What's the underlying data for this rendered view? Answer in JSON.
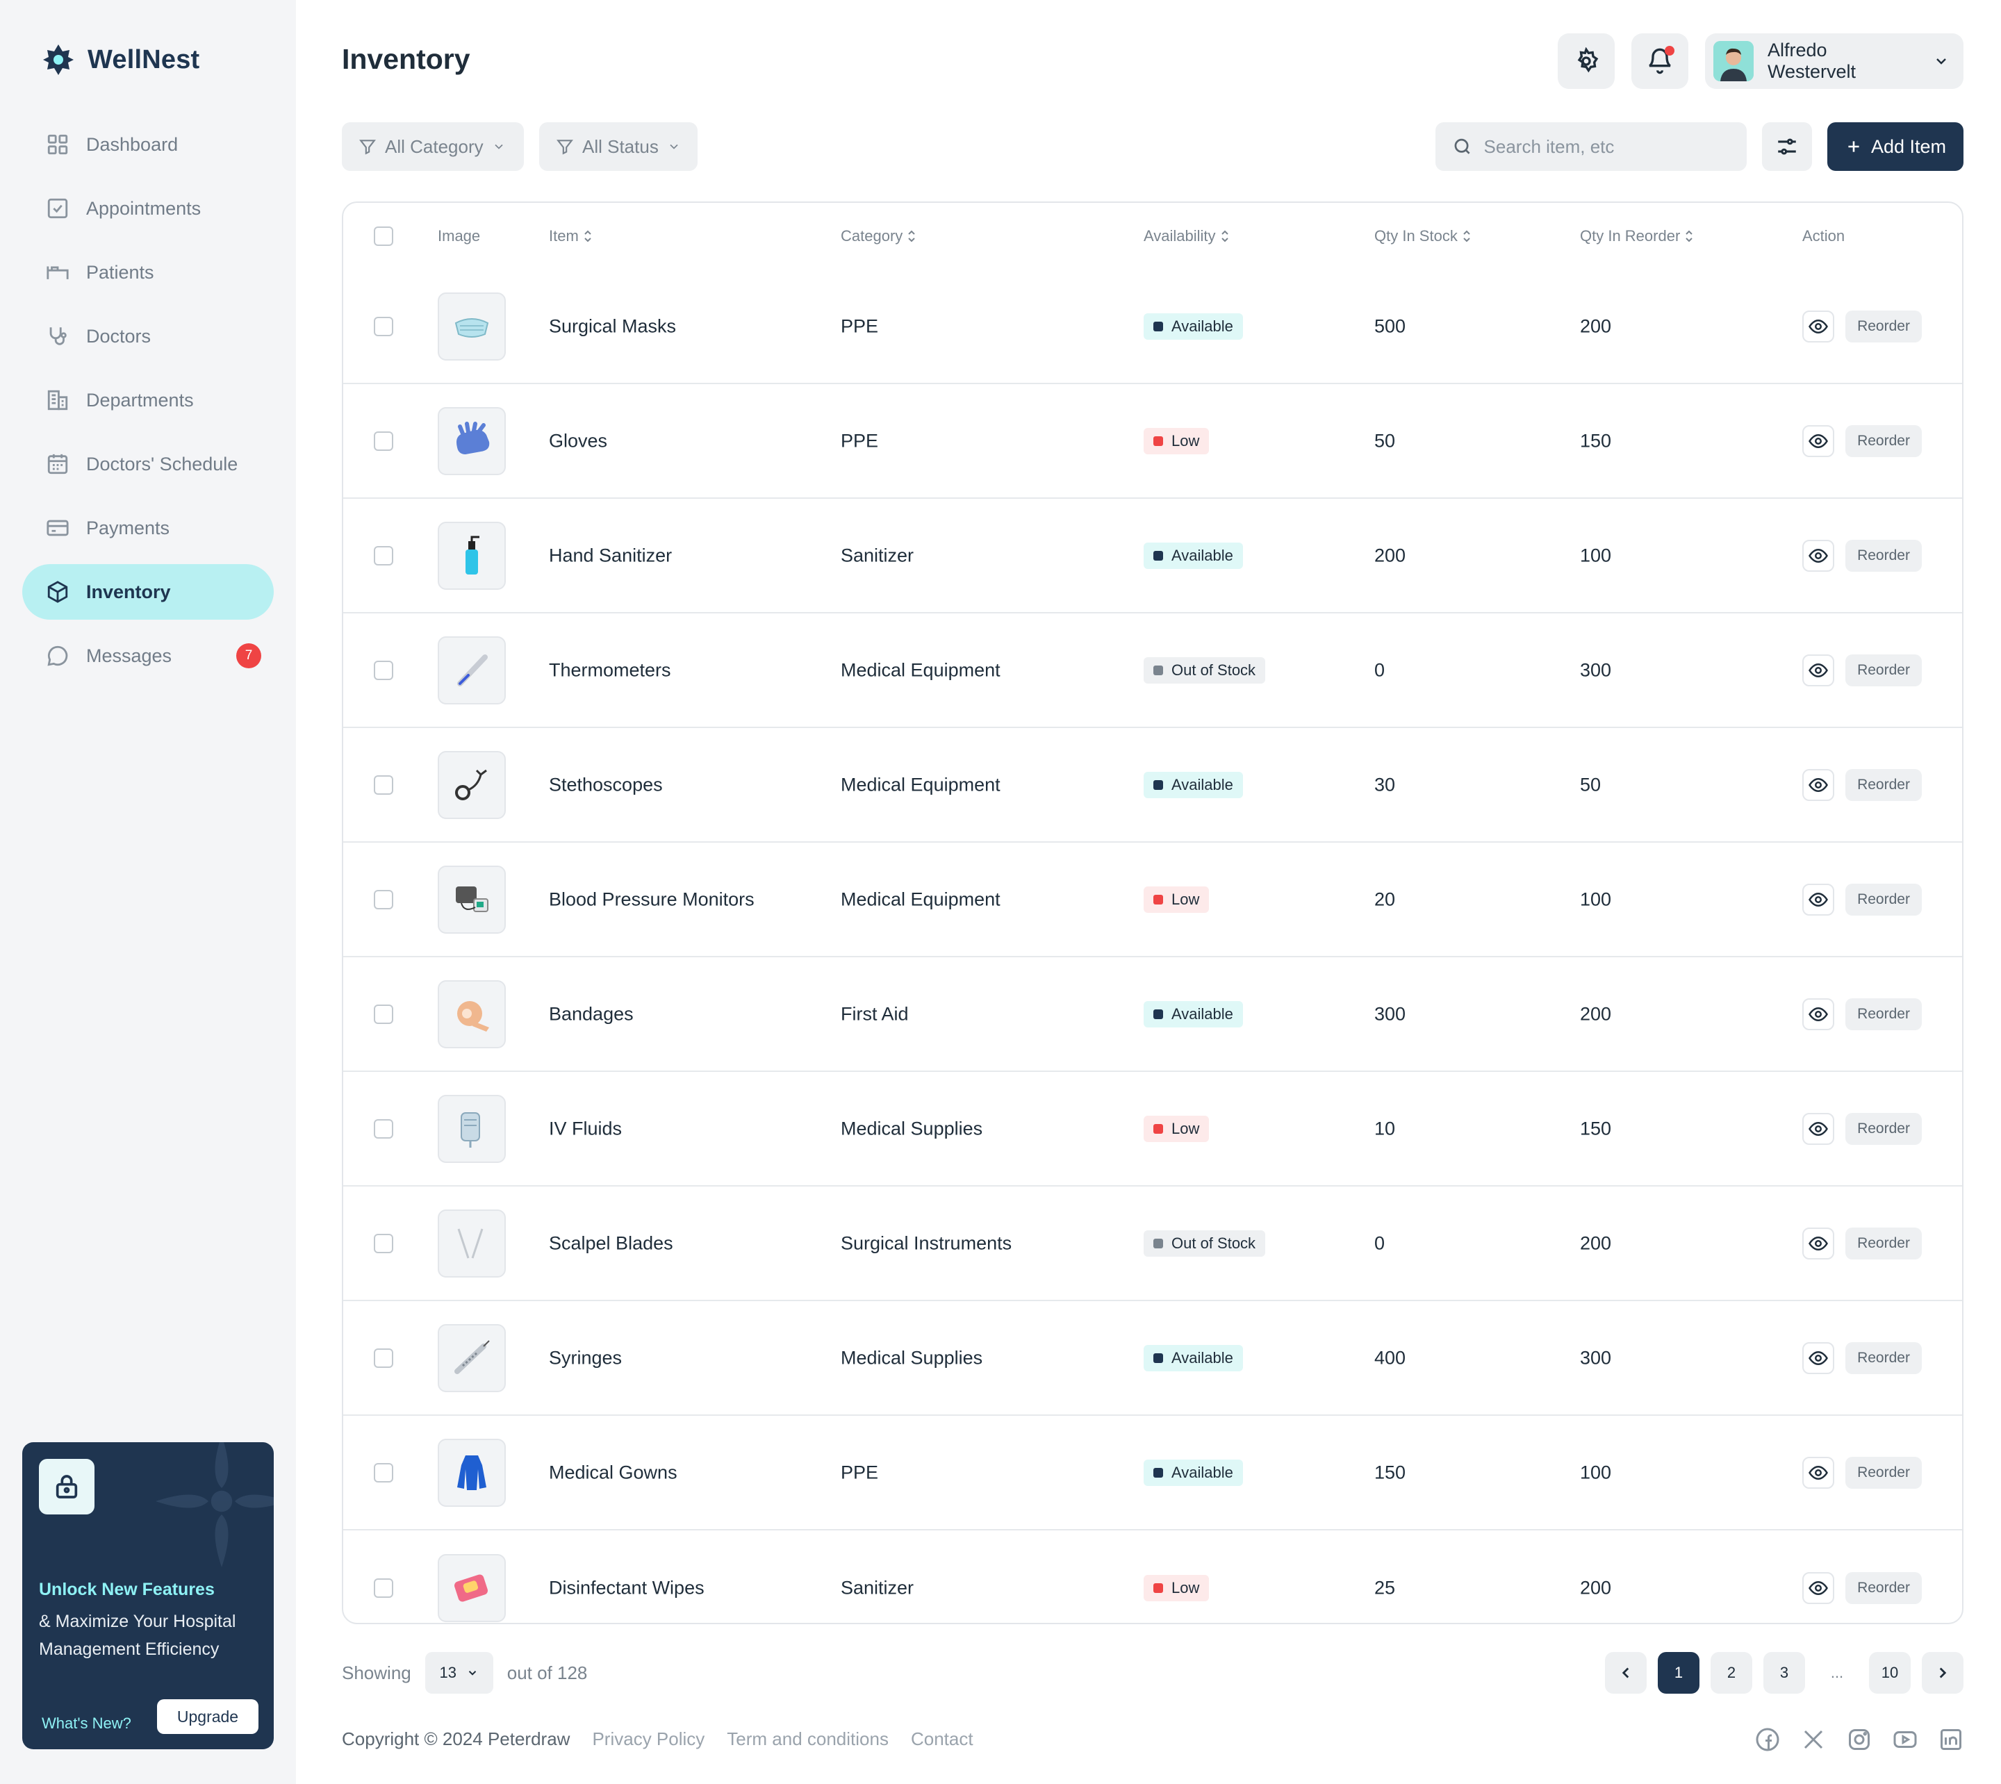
{
  "brand": {
    "name": "WellNest"
  },
  "sidebar": {
    "items": [
      {
        "label": "Dashboard",
        "icon": "grid-icon"
      },
      {
        "label": "Appointments",
        "icon": "calendar-check-icon"
      },
      {
        "label": "Patients",
        "icon": "bed-icon"
      },
      {
        "label": "Doctors",
        "icon": "stethoscope-icon"
      },
      {
        "label": "Departments",
        "icon": "building-icon"
      },
      {
        "label": "Doctors' Schedule",
        "icon": "calendar-icon"
      },
      {
        "label": "Payments",
        "icon": "credit-card-icon"
      },
      {
        "label": "Inventory",
        "icon": "box-icon",
        "active": true
      },
      {
        "label": "Messages",
        "icon": "chat-icon",
        "badge": "7"
      }
    ],
    "promo": {
      "title": "Unlock New Features",
      "subtitle": "& Maximize Your Hospital Management Efficiency",
      "link": "What's New?",
      "button": "Upgrade"
    }
  },
  "header": {
    "title": "Inventory",
    "user_name": "Alfredo Westervelt"
  },
  "toolbar": {
    "category_filter": "All Category",
    "status_filter": "All Status",
    "search_placeholder": "Search item, etc",
    "add_label": "Add Item"
  },
  "table": {
    "columns": {
      "image": "Image",
      "item": "Item",
      "category": "Category",
      "availability": "Availability",
      "qty_stock": "Qty In Stock",
      "qty_reorder": "Qty In Reorder",
      "action": "Action"
    },
    "reorder_label": "Reorder",
    "rows": [
      {
        "item": "Surgical Masks",
        "category": "PPE",
        "status": "Available",
        "stock": "500",
        "reorder": "200",
        "icon": "mask-icon"
      },
      {
        "item": "Gloves",
        "category": "PPE",
        "status": "Low",
        "stock": "50",
        "reorder": "150",
        "icon": "gloves-icon"
      },
      {
        "item": "Hand Sanitizer",
        "category": "Sanitizer",
        "status": "Available",
        "stock": "200",
        "reorder": "100",
        "icon": "sanitizer-icon"
      },
      {
        "item": "Thermometers",
        "category": "Medical Equipment",
        "status": "Out of Stock",
        "stock": "0",
        "reorder": "300",
        "icon": "thermometer-icon"
      },
      {
        "item": "Stethoscopes",
        "category": "Medical Equipment",
        "status": "Available",
        "stock": "30",
        "reorder": "50",
        "icon": "stethoscope-icon"
      },
      {
        "item": "Blood Pressure Monitors",
        "category": "Medical Equipment",
        "status": "Low",
        "stock": "20",
        "reorder": "100",
        "icon": "bp-monitor-icon"
      },
      {
        "item": "Bandages",
        "category": "First Aid",
        "status": "Available",
        "stock": "300",
        "reorder": "200",
        "icon": "bandage-icon"
      },
      {
        "item": "IV Fluids",
        "category": "Medical Supplies",
        "status": "Low",
        "stock": "10",
        "reorder": "150",
        "icon": "iv-bag-icon"
      },
      {
        "item": "Scalpel Blades",
        "category": "Surgical Instruments",
        "status": "Out of Stock",
        "stock": "0",
        "reorder": "200",
        "icon": "scalpel-icon"
      },
      {
        "item": "Syringes",
        "category": "Medical Supplies",
        "status": "Available",
        "stock": "400",
        "reorder": "300",
        "icon": "syringe-icon"
      },
      {
        "item": "Medical Gowns",
        "category": "PPE",
        "status": "Available",
        "stock": "150",
        "reorder": "100",
        "icon": "gown-icon"
      },
      {
        "item": "Disinfectant Wipes",
        "category": "Sanitizer",
        "status": "Low",
        "stock": "25",
        "reorder": "200",
        "icon": "wipes-icon"
      }
    ]
  },
  "pagination": {
    "showing_label": "Showing",
    "page_size": "13",
    "total_label": "out of 128",
    "pages": [
      "1",
      "2",
      "3",
      "...",
      "10"
    ],
    "current": "1"
  },
  "footer": {
    "copyright": "Copyright © 2024 Peterdraw",
    "links": [
      "Privacy Policy",
      "Term and conditions",
      "Contact"
    ]
  },
  "colors": {
    "navy": "#1f3550",
    "active_nav": "#b8f0f2",
    "available": "#dff8f7",
    "low": "#ef4444",
    "accent_cyan": "#8ff2f5"
  }
}
